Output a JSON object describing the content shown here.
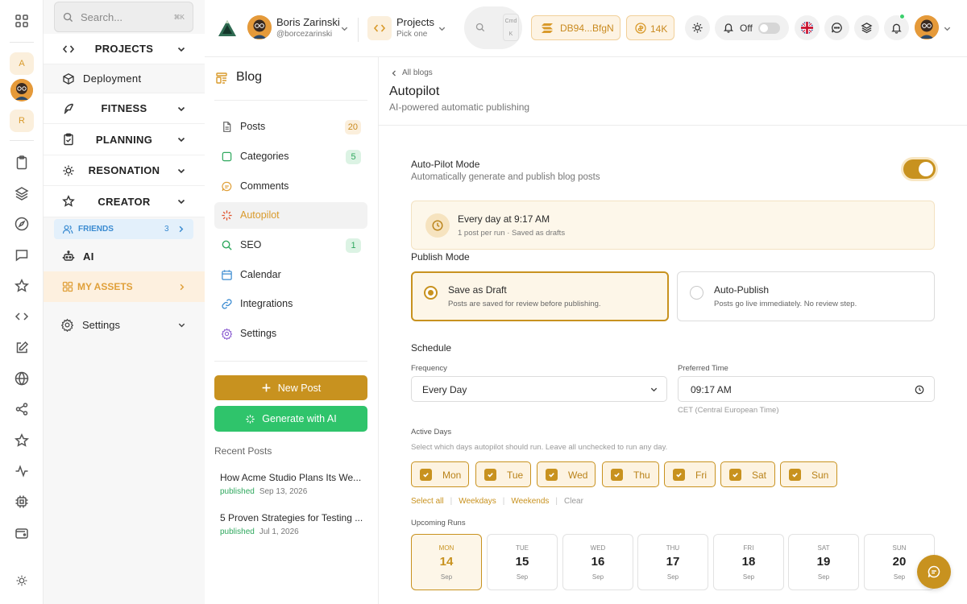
{
  "rail": {
    "badges": [
      "A",
      "R"
    ],
    "icons": [
      "grid-icon",
      "clipboard-icon",
      "layers-icon",
      "compass-icon",
      "chat-icon",
      "star-icon",
      "code-icon",
      "edit-icon",
      "globe-icon",
      "share-icon",
      "star-outline-icon",
      "activity-icon",
      "chip-icon",
      "wallet-icon",
      "sun-icon"
    ]
  },
  "sidenav": {
    "search_placeholder": "Search...",
    "search_shortcut": "⌘K",
    "items": [
      {
        "label": "PROJECTS",
        "icon": "code-icon"
      },
      {
        "label": "Deployment",
        "icon": "box-icon"
      },
      {
        "label": "FITNESS",
        "icon": "feather-icon"
      },
      {
        "label": "PLANNING",
        "icon": "clipboard-check-icon"
      },
      {
        "label": "RESONATION",
        "icon": "sun-icon"
      },
      {
        "label": "CREATOR",
        "icon": "star-icon"
      },
      {
        "label": "AI",
        "icon": "robot-icon"
      }
    ],
    "friends": {
      "label": "FRIENDS",
      "count": "3"
    },
    "assets": {
      "label": "MY ASSETS"
    },
    "settings": {
      "label": "Settings"
    }
  },
  "header": {
    "user_name": "Boris Zarinski",
    "user_handle": "@borcezarinski",
    "project_label": "Projects",
    "project_sub": "Pick one",
    "search_kbd_1": "Cmd",
    "search_kbd_2": "K",
    "wallet": "DB94...BfgN",
    "coins": "14K",
    "notifications_label": "Off",
    "notifications_on": false
  },
  "blog": {
    "title": "Blog",
    "menu": [
      {
        "label": "Posts",
        "count": "20",
        "icon": "file-icon"
      },
      {
        "label": "Categories",
        "count": "5",
        "icon": "folder-icon"
      },
      {
        "label": "Comments",
        "count": "",
        "icon": "comment-icon"
      },
      {
        "label": "Autopilot",
        "count": "",
        "icon": "sparkle-icon"
      },
      {
        "label": "SEO",
        "count": "1",
        "icon": "search-icon"
      },
      {
        "label": "Calendar",
        "count": "",
        "icon": "calendar-icon"
      },
      {
        "label": "Integrations",
        "count": "",
        "icon": "link-icon"
      },
      {
        "label": "Settings",
        "count": "",
        "icon": "gear-icon"
      }
    ],
    "new_post": "New Post",
    "generate": "Generate with AI",
    "recent_heading": "Recent Posts",
    "recent": [
      {
        "title": "How Acme Studio Plans Its We...",
        "status": "published",
        "date": "Sep 13, 2026"
      },
      {
        "title": "5 Proven Strategies for Testing ...",
        "status": "published",
        "date": "Jul 1, 2026"
      }
    ]
  },
  "main": {
    "breadcrumb": "All blogs",
    "title": "Autopilot",
    "subtitle": "AI-powered automatic publishing",
    "autopilot_title": "Auto-Pilot Mode",
    "autopilot_desc": "Automatically generate and publish blog posts",
    "autopilot_enabled": true,
    "schedule_summary": "Every day at 9:17 AM",
    "schedule_detail": "1 post per run · Saved as drafts",
    "publish_mode_label": "Publish Mode",
    "modes": [
      {
        "title": "Save as Draft",
        "desc": "Posts are saved for review before publishing.",
        "selected": true
      },
      {
        "title": "Auto-Publish",
        "desc": "Posts go live immediately. No review step.",
        "selected": false
      }
    ],
    "schedule_label": "Schedule",
    "frequency_label": "Frequency",
    "frequency_value": "Every Day",
    "time_label": "Preferred Time",
    "time_value": "09:17 AM",
    "timezone": "CET (Central European Time)",
    "active_days_label": "Active Days",
    "active_days_hint": "Select which days autopilot should run. Leave all unchecked to run any day.",
    "days": [
      {
        "label": "Mon",
        "checked": true
      },
      {
        "label": "Tue",
        "checked": true
      },
      {
        "label": "Wed",
        "checked": true
      },
      {
        "label": "Thu",
        "checked": true
      },
      {
        "label": "Fri",
        "checked": true
      },
      {
        "label": "Sat",
        "checked": true
      },
      {
        "label": "Sun",
        "checked": true
      }
    ],
    "day_links": {
      "select_all": "Select all",
      "weekdays": "Weekdays",
      "weekends": "Weekends",
      "clear": "Clear"
    },
    "upcoming_label": "Upcoming Runs",
    "upcoming": [
      {
        "dow": "MON",
        "day": "14",
        "month": "Sep"
      },
      {
        "dow": "TUE",
        "day": "15",
        "month": "Sep"
      },
      {
        "dow": "WED",
        "day": "16",
        "month": "Sep"
      },
      {
        "dow": "THU",
        "day": "17",
        "month": "Sep"
      },
      {
        "dow": "FRI",
        "day": "18",
        "month": "Sep"
      },
      {
        "dow": "SAT",
        "day": "19",
        "month": "Sep"
      },
      {
        "dow": "SUN",
        "day": "20",
        "month": "Sep"
      }
    ]
  },
  "colors": {
    "accent": "#c8921f",
    "accent_light": "#fdf3e1",
    "green": "#2fc46b",
    "blue": "#3a8bd1"
  }
}
